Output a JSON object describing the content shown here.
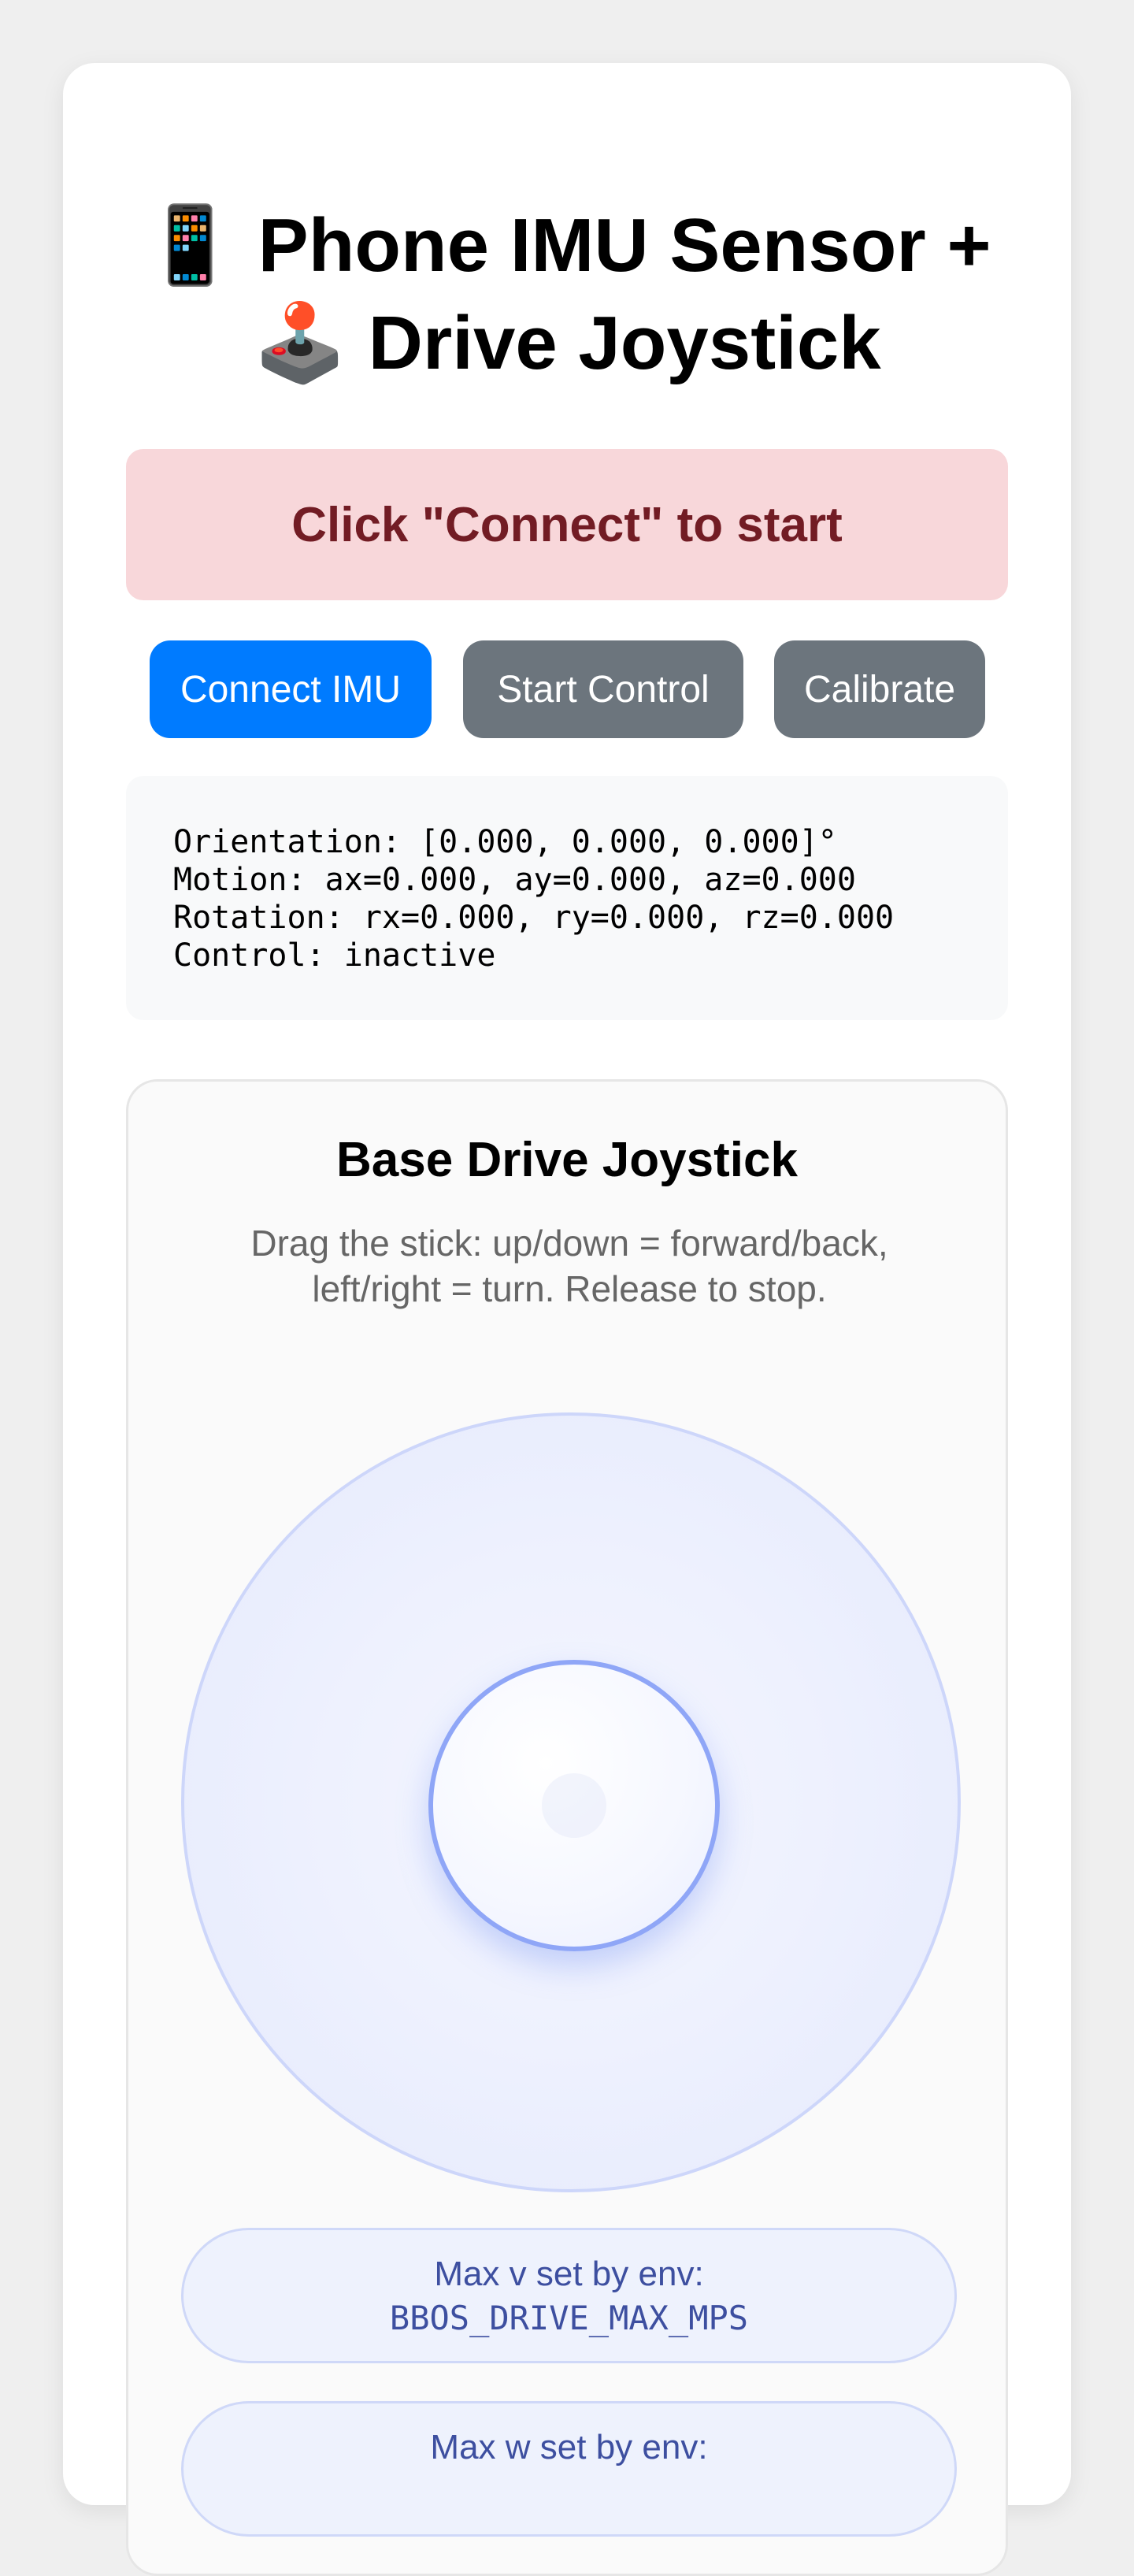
{
  "header": {
    "title_line1": "📱 Phone IMU Sensor +",
    "title_line2": "🕹️ Drive Joystick"
  },
  "status": {
    "message": "Click \"Connect\" to start",
    "colors": {
      "background": "#f8d7da",
      "text": "#721c24"
    }
  },
  "buttons": {
    "connect_label": "Connect IMU",
    "start_label": "Start Control",
    "calibrate_label": "Calibrate",
    "colors": {
      "primary": "#007bff",
      "secondary": "#6c757d"
    }
  },
  "readout": {
    "orientation": "Orientation: [0.000, 0.000, 0.000]°",
    "motion": "Motion: ax=0.000, ay=0.000, az=0.000",
    "rotation": "Rotation: rx=0.000, ry=0.000, rz=0.000",
    "control": "Control: inactive"
  },
  "joystick": {
    "title": "Base Drive Joystick",
    "description": "Drag the stick: up/down = forward/back, left/right = turn. Release to stop.",
    "stick": {
      "x": 0,
      "y": 0
    },
    "max_v": {
      "label": "Max v set by env:",
      "env": "BBOS_DRIVE_MAX_MPS"
    },
    "max_w": {
      "label": "Max w set by env:",
      "env": ""
    }
  }
}
